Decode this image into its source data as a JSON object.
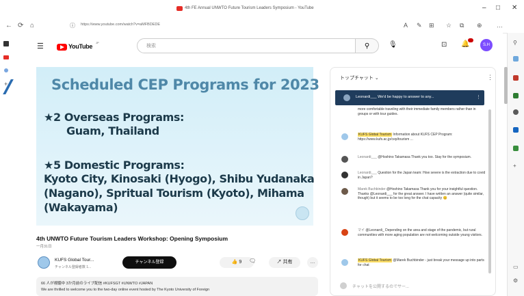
{
  "browser": {
    "tab_title": "4th FE Annual UNWTO Future Tourism Leaders Symposium - YouTube",
    "url": "https://www.youtube.com/watch?v=aMFBDEDE",
    "window_controls": [
      "–",
      "□",
      "✕"
    ],
    "nav_icons": [
      "←",
      "⟳",
      "⌂"
    ],
    "toolbar_icons": [
      "A",
      "✎",
      "⊞",
      "☆",
      "⧉",
      "⊕",
      "…"
    ]
  },
  "youtube": {
    "logo_text": "YouTube",
    "logo_sup": "JP",
    "search_placeholder": "検索",
    "avatar_initials": "S.H"
  },
  "video": {
    "slide_title": "Scheduled CEP Programs for 2023",
    "lines": [
      "★2 Overseas Programs:",
      "Guam, Thailand",
      "★5 Domestic Programs:",
      "Kyoto City, Kinosaki (Hyogo), Shibu Yudanaka",
      "(Nagano), Spritual Tourism (Kyoto), Mihama",
      "(Wakayama)"
    ],
    "title": "4th UNWTO Future Tourism Leaders Workshop: Opening Symposium",
    "date": "一月31日",
    "channel_name": "KUFS Global Tour...",
    "channel_subs": "チャンネル登録者数 1...",
    "subscribe_label": "チャンネル登録",
    "like_count": "9",
    "share_label": "共有",
    "more_label": "…",
    "desc_line1": "66 人が視聴中  3か月前のライブ配信  #KUFSGT #UNWTO #JAPAN",
    "desc_line2": "We are thrilled to welcome you to the two-day online event hosted by The Kyoto University of Foreign"
  },
  "chat": {
    "header": "トップチャット ⌄",
    "menu": "⋮",
    "pinned_text": "Leonardi___  We'd be happy to answer to any...",
    "messages": [
      {
        "author": "",
        "text": "more comfortable traveling with their immediate family members rather than in groups or with tour guides.",
        "avatar_color": "#ffffff"
      },
      {
        "author": "KUFS Global Tourism",
        "text": "Information about KUFS CEP Program: https://www.kufs.ac.jp/cep/tourism ...",
        "avatar_color": "#9fc8ea"
      },
      {
        "author": "Leonardi___",
        "text": "@Hoshino Takamasa Thank you too. Stay for the symposium.",
        "avatar_color": "#555555"
      },
      {
        "author": "Leonardi___",
        "text": "Question for the Japan team: How severe is the extraction due to covid in Japan?",
        "avatar_color": "#333333"
      },
      {
        "author": "Marek Buchbinder",
        "text": "@Hoshino Takamasa Thank you for your insightful question. Thanks @Leonardi___ for the great answer. I have written an answer (quite similar, though) but it seems to be too long for the chat capacity 😊",
        "avatar_color": "#6d5a4a"
      },
      {
        "author": "マイ",
        "text": "@Leonardi_ Depending on the area and stage of the pandemic, but rural communities with more aging population are not welcoming outside young visitors.",
        "avatar_color": "#d84315"
      },
      {
        "author": "KUFS Global Tourism",
        "text": "@Marek Buchbinder - just break your message up into parts for chat",
        "avatar_color": "#9fc8ea"
      }
    ],
    "input_placeholder": "チャットを公開するのでサー..."
  },
  "colors": {
    "youtube_red": "#ff0000",
    "pinned_bg": "#1f3c5c",
    "slide_bg": "#d2eef8",
    "highlight": "#ffe066"
  }
}
